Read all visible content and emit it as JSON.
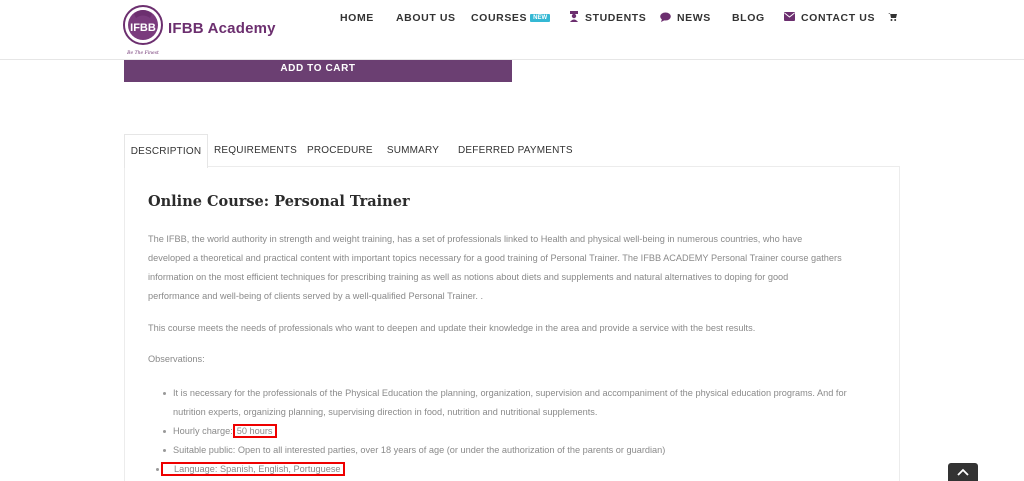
{
  "brand": {
    "name": "IFBB Academy",
    "badge_text": "IFBB",
    "tagline": "Be The Finest"
  },
  "nav": {
    "home": "HOME",
    "about": "ABOUT US",
    "courses": "COURSES",
    "new_badge": "NEW",
    "students": "STUDENTS",
    "news": "NEWS",
    "blog": "BLOG",
    "contact": "CONTACT US"
  },
  "product": {
    "add_to_cart": "ADD TO CART"
  },
  "tabs": [
    {
      "label": "DESCRIPTION"
    },
    {
      "label": "REQUIREMENTS"
    },
    {
      "label": "PROCEDURE"
    },
    {
      "label": "SUMMARY"
    },
    {
      "label": "DEFERRED PAYMENTS"
    }
  ],
  "description": {
    "title": "Online Course: Personal Trainer",
    "para1_lines": [
      "The IFBB, the world authority in strength and weight training, has a set of professionals linked to Health and physical well-being in numerous countries, who have",
      "developed a theoretical and practical content with important topics necessary for a good training of Personal Trainer. The IFBB ACADEMY Personal Trainer course gathers",
      "information on the most efficient techniques for prescribing training as well as notions about diets and supplements and natural alternatives to doping for good",
      "performance and well-being of clients served by a well-qualified Personal Trainer. ."
    ],
    "para2": "This course meets the needs of professionals who want to deepen and update their knowledge in the area and provide a service with the best results.",
    "observations": "Observations:",
    "bullet1_lines": [
      "It is necessary for the professionals of the Physical Education the planning, organization, supervision and accompaniment of the physical education programs. And for",
      "nutrition experts, organizing planning, supervising direction in food, nutrition and nutritional supplements."
    ],
    "hourly_prefix": "Hourly charge:",
    "hourly_value": "50 hours",
    "public": "Suitable public: Open to all interested parties, over 18 years of age (or under the authorization of the parents or guardian)",
    "language": "Language: Spanish, English, Portuguese"
  },
  "colors": {
    "brand_purple": "#6b3f72",
    "new_badge": "#34b8d4",
    "highlight": "#ee0000"
  }
}
